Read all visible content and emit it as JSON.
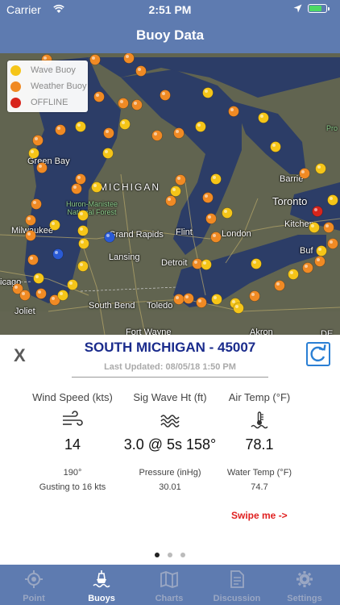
{
  "status_bar": {
    "carrier": "Carrier",
    "time": "2:51 PM"
  },
  "nav": {
    "title": "Buoy Data"
  },
  "map": {
    "legend": [
      {
        "label": "Wave Buoy",
        "color": "#f5c518"
      },
      {
        "label": "Weather Buoy",
        "color": "#f08a24"
      },
      {
        "label": "OFFLINE",
        "color": "#d8251c"
      }
    ],
    "labels": {
      "green_bay": "Green Bay",
      "michigan": "MICHIGAN",
      "huron_manistee": "Huron-Manistee",
      "national_forest": "National Forest",
      "milwaukee": "Milwaukee",
      "grand_rapids": "Grand Rapids",
      "flint": "Flint",
      "london": "London",
      "lansing": "Lansing",
      "detroit": "Detroit",
      "chicago": "icago",
      "joliet": "Joliet",
      "south_bend": "South Bend",
      "toledo": "Toledo",
      "fort_wayne": "Fort Wayne",
      "akron": "Akron",
      "barrie": "Barrie",
      "toronto": "Toronto",
      "kitchener": "Kitchen",
      "buffalo": "Buf",
      "pro": "Pro",
      "de": "DE"
    }
  },
  "detail": {
    "close_label": "X",
    "station": "SOUTH MICHIGAN - 45007",
    "last_updated": "Last Updated: 08/05/18 1:50 PM",
    "wind": {
      "header": "Wind Speed (kts)",
      "value": "14",
      "sub1": "190°",
      "sub2": "Gusting to 16 kts",
      "icon": "wind-icon"
    },
    "wave": {
      "header": "Sig Wave Ht (ft)",
      "value": "3.0 @ 5s 158°",
      "sub1": "Pressure (inHg)",
      "sub2": "30.01",
      "icon": "waves-icon"
    },
    "air": {
      "header": "Air Temp (°F)",
      "value": "78.1",
      "sub1": "Water Temp (°F)",
      "sub2": "74.7",
      "icon": "thermometer-icon"
    },
    "swipe": "Swipe me ->"
  },
  "tabs": [
    {
      "label": "Point",
      "icon": "target-icon",
      "active": false
    },
    {
      "label": "Buoys",
      "icon": "buoy-icon",
      "active": true
    },
    {
      "label": "Charts",
      "icon": "map-icon",
      "active": false
    },
    {
      "label": "Discussion",
      "icon": "document-icon",
      "active": false
    },
    {
      "label": "Settings",
      "icon": "gear-icon",
      "active": false
    }
  ]
}
